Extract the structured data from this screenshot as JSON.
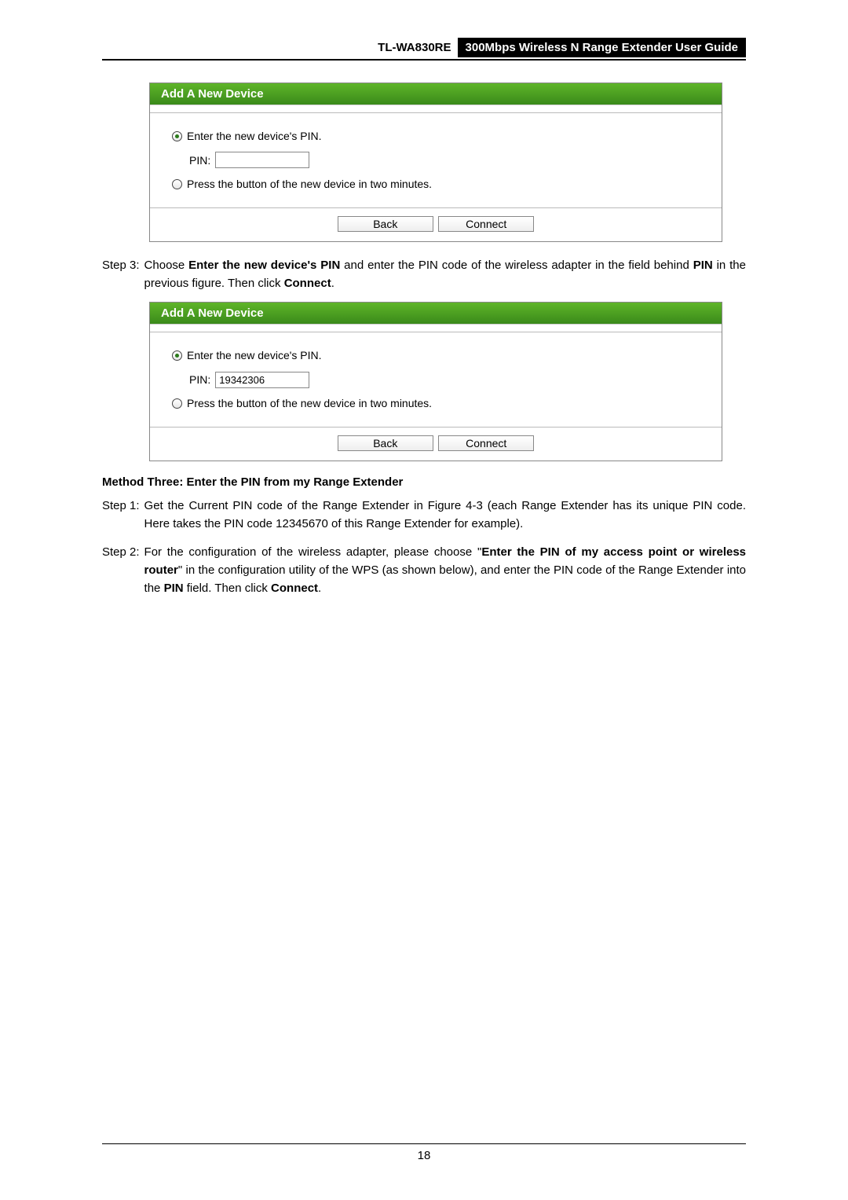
{
  "header": {
    "model": "TL-WA830RE",
    "title": "300Mbps Wireless N Range Extender User Guide"
  },
  "panel1": {
    "title": "Add A New Device",
    "opt1_label": "Enter the new device's PIN.",
    "pin_label": "PIN:",
    "pin_value": "",
    "opt2_label": "Press the button of the new device in two minutes.",
    "back_label": "Back",
    "connect_label": "Connect"
  },
  "step3": {
    "label": "Step 3:",
    "text_a": "Choose ",
    "bold_a": "Enter the new device's PIN",
    "text_b": " and enter the PIN code of the wireless adapter in the field behind ",
    "bold_b": "PIN",
    "text_c": " in the previous figure. Then click ",
    "bold_c": "Connect",
    "text_d": "."
  },
  "panel2": {
    "title": "Add A New Device",
    "opt1_label": "Enter the new device's PIN.",
    "pin_label": "PIN:",
    "pin_value": "19342306",
    "opt2_label": "Press the button of the new device in two minutes.",
    "back_label": "Back",
    "connect_label": "Connect"
  },
  "method_title": "Method Three: Enter the PIN from my Range Extender",
  "m_step1": {
    "label": "Step 1:",
    "text": "Get the Current PIN code of the Range Extender in Figure 4-3 (each Range Extender has its unique PIN code. Here takes the PIN code 12345670 of this Range Extender for example)."
  },
  "m_step2": {
    "label": "Step 2:",
    "text_a": "For the configuration of the wireless adapter, please choose \"",
    "bold_a": "Enter the PIN of my access point or wireless router",
    "text_b": "\" in the configuration utility of the WPS (as shown below), and enter the PIN code of the Range Extender into the ",
    "bold_b": "PIN",
    "text_c": " field. Then click ",
    "bold_c": "Connect",
    "text_d": "."
  },
  "page_number": "18"
}
